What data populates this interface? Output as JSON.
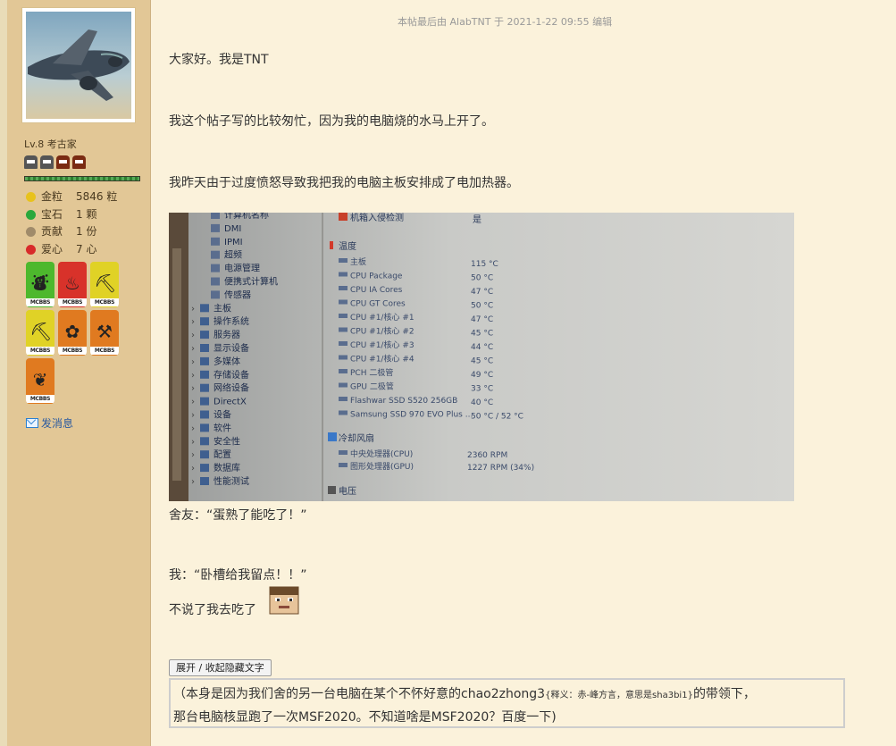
{
  "user": {
    "level": "Lv.8 考古家",
    "stats": [
      {
        "label": "金粒",
        "value": "5846 粒",
        "color": "#e8c21c",
        "icon": "gold-nugget-icon"
      },
      {
        "label": "宝石",
        "value": "1 颗",
        "color": "#2aa83c",
        "icon": "gem-icon"
      },
      {
        "label": "贡献",
        "value": "1 份",
        "color": "#a08b6a",
        "icon": "contribution-icon"
      },
      {
        "label": "爱心",
        "value": "7 心",
        "color": "#d82a2a",
        "icon": "heart-icon"
      }
    ],
    "medals": [
      {
        "bg": "#4db82d",
        "glyph": "⛇",
        "tag": "MCBBS"
      },
      {
        "bg": "#d8322a",
        "glyph": "♨",
        "tag": "MCBBS"
      },
      {
        "bg": "#e0d226",
        "glyph": "⛏",
        "tag": "MCBBS"
      },
      {
        "bg": "#e0d226",
        "glyph": "⛏",
        "tag": "MCBBS"
      },
      {
        "bg": "#e07a20",
        "glyph": "✿",
        "tag": "MCBBS"
      },
      {
        "bg": "#e07a20",
        "glyph": "⚒",
        "tag": "MCBBS"
      },
      {
        "bg": "#e07a20",
        "glyph": "❦",
        "tag": "MCBBS"
      }
    ],
    "send_message": "发消息"
  },
  "post": {
    "edit_note": "本帖最后由 AlabTNT 于 2021-1-22 09:55 编辑",
    "greeting": "大家好。我是TNT",
    "line2": "我这个帖子写的比较匆忙，因为我的电脑烧的水马上开了。",
    "line3": "我昨天由于过度愤怒导致我把我的电脑主板安排成了电加热器。",
    "quote1": "舍友：“蛋熟了能吃了！”",
    "quote2": "我：“卧槽给我留点！！”",
    "line_last": "不说了我去吃了",
    "toggle_label": "展开 / 收起隐藏文字",
    "hidden_a": "（本身是因为我们舍的另一台电脑在某个不怀好意的chao2zhong3",
    "hidden_note": "{释义：赤-峰方言，意思是sha3bi1}",
    "hidden_b": "的带领下，",
    "hidden_c": "那台电脑核显跑了一次MSF2020。不知道啥是MSF2020？百度一下)"
  },
  "screenshot": {
    "tree": [
      "计算机名称",
      "DMI",
      "IPMI",
      "超频",
      "电源管理",
      "便携式计算机",
      "传感器",
      "主板",
      "操作系统",
      "服务器",
      "显示设备",
      "多媒体",
      "存储设备",
      "网络设备",
      "DirectX",
      "设备",
      "软件",
      "安全性",
      "配置",
      "数据库",
      "性能测试"
    ],
    "intrusion_label": "机箱入侵检测",
    "intrusion_value": "是",
    "temp_header": "温度",
    "temps": [
      {
        "label": "主板",
        "value": "115 °C"
      },
      {
        "label": "CPU Package",
        "value": "50 °C"
      },
      {
        "label": "CPU IA Cores",
        "value": "47 °C"
      },
      {
        "label": "CPU GT Cores",
        "value": "50 °C"
      },
      {
        "label": "CPU #1/核心 #1",
        "value": "47 °C"
      },
      {
        "label": "CPU #1/核心 #2",
        "value": "45 °C"
      },
      {
        "label": "CPU #1/核心 #3",
        "value": "44 °C"
      },
      {
        "label": "CPU #1/核心 #4",
        "value": "45 °C"
      },
      {
        "label": "PCH 二极管",
        "value": "49 °C"
      },
      {
        "label": "GPU 二极管",
        "value": "33 °C"
      },
      {
        "label": "Flashwar SSD S520 256GB",
        "value": "40 °C"
      },
      {
        "label": "Samsung SSD 970 EVO Plus ...",
        "value": "50 °C / 52 °C"
      }
    ],
    "fan_header": "冷却风扇",
    "fans": [
      {
        "label": "中央处理器(CPU)",
        "value": "2360 RPM"
      },
      {
        "label": "图形处理器(GPU)",
        "value": "1227 RPM  (34%)"
      }
    ],
    "volt_header": "电压"
  }
}
